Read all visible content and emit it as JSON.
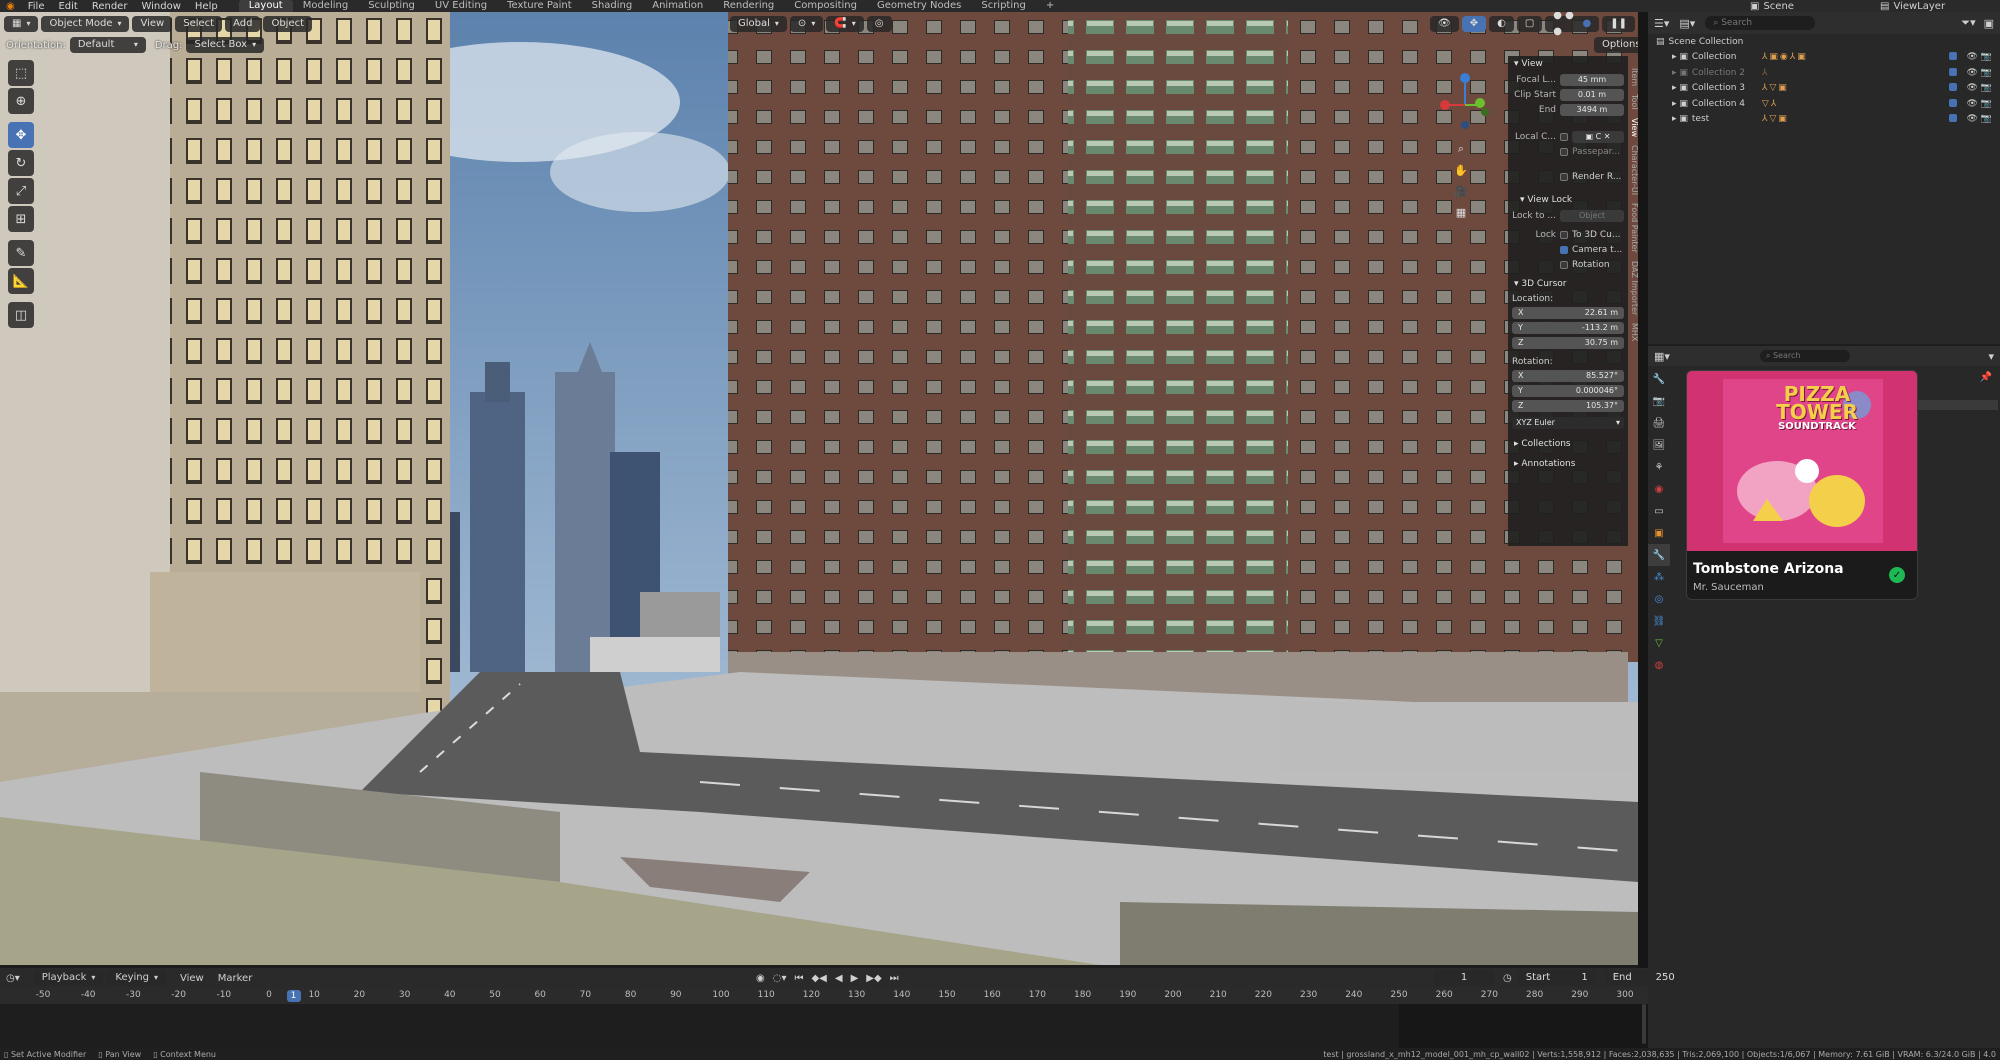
{
  "topbar": {
    "menus": [
      "File",
      "Edit",
      "Render",
      "Window",
      "Help"
    ],
    "workspaces": [
      "Layout",
      "Modeling",
      "Sculpting",
      "UV Editing",
      "Texture Paint",
      "Shading",
      "Animation",
      "Rendering",
      "Compositing",
      "Geometry Nodes",
      "Scripting"
    ],
    "active_workspace": "Layout",
    "scene": "Scene",
    "view_layer": "ViewLayer"
  },
  "viewport": {
    "mode": "Object Mode",
    "menus": [
      "View",
      "Select",
      "Add",
      "Object"
    ],
    "transform_orientation": "Global",
    "orientation_label": "Orientation:",
    "orientation_value": "Default",
    "drag_label": "Drag:",
    "drag_value": "Select Box",
    "options": "Options"
  },
  "npanel": {
    "view_title": "View",
    "focal_label": "Focal L...",
    "focal_value": "45 mm",
    "clip_start_label": "Clip Start",
    "clip_start_value": "0.01 m",
    "end_label": "End",
    "end_value": "3494 m",
    "local_camera_label": "Local C...",
    "passepartout": "Passepar...",
    "render_region": "Render R...",
    "view_lock_title": "View Lock",
    "lock_to_label": "Lock to ...",
    "lock_to_value": "Object",
    "lock_label": "Lock",
    "to_3d_cursor": "To 3D Cu...",
    "camera_to_view": "Camera t...",
    "rotation_chk": "Rotation",
    "cursor_title": "3D Cursor",
    "location_label": "Location:",
    "loc_x": "22.61 m",
    "loc_y": "-113.2 m",
    "loc_z": "30.75 m",
    "rotation_label": "Rotation:",
    "rot_x": "85.527°",
    "rot_y": "0.000046°",
    "rot_z": "105.37°",
    "rotation_mode": "XYZ Euler",
    "collections": "Collections",
    "annotations": "Annotations",
    "tabs": [
      "Item",
      "Tool",
      "View",
      "Character-UI",
      "Food Painter",
      "DAZ Importer",
      "MHX"
    ]
  },
  "outliner": {
    "search_placeholder": "Search",
    "root": "Scene Collection",
    "rows": [
      {
        "name": "Collection",
        "dim": false
      },
      {
        "name": "Collection 2",
        "dim": true
      },
      {
        "name": "Collection 3",
        "dim": false
      },
      {
        "name": "Collection 4",
        "dim": false
      },
      {
        "name": "test",
        "dim": false
      }
    ]
  },
  "properties": {
    "search_placeholder": "Search"
  },
  "spotify": {
    "art_text_line1": "PIZZA",
    "art_text_line2": "TOWER",
    "art_text_line3": "SOUNDTRACK",
    "title": "Tombstone Arizona",
    "artist": "Mr. Sauceman",
    "accent": "#1db954"
  },
  "timeline": {
    "menus": [
      "Playback",
      "Keying",
      "View",
      "Marker"
    ],
    "current_frame": "1",
    "start_label": "Start",
    "start_value": "1",
    "end_label": "End",
    "end_value": "250",
    "ticks": [
      "-50",
      "-40",
      "-30",
      "-20",
      "-10",
      "0",
      "10",
      "20",
      "30",
      "40",
      "50",
      "60",
      "70",
      "80",
      "90",
      "100",
      "110",
      "120",
      "130",
      "140",
      "150",
      "160",
      "170",
      "180",
      "190",
      "200",
      "210",
      "220",
      "230",
      "240",
      "250",
      "260",
      "270",
      "280",
      "290",
      "300"
    ],
    "playhead_frame": "1"
  },
  "statusbar": {
    "left": [
      "Set Active Modifier",
      "Pan View",
      "Context Menu"
    ],
    "right": "test | grossland_x_mh12_model_001_mh_cp_wall02 | Verts:1,558,912 | Faces:2,038,635 | Tris:2,069,100 | Objects:1/6,067 | Memory: 7.61 GiB | VRAM: 6.3/24.0 GiB | 4.0"
  }
}
